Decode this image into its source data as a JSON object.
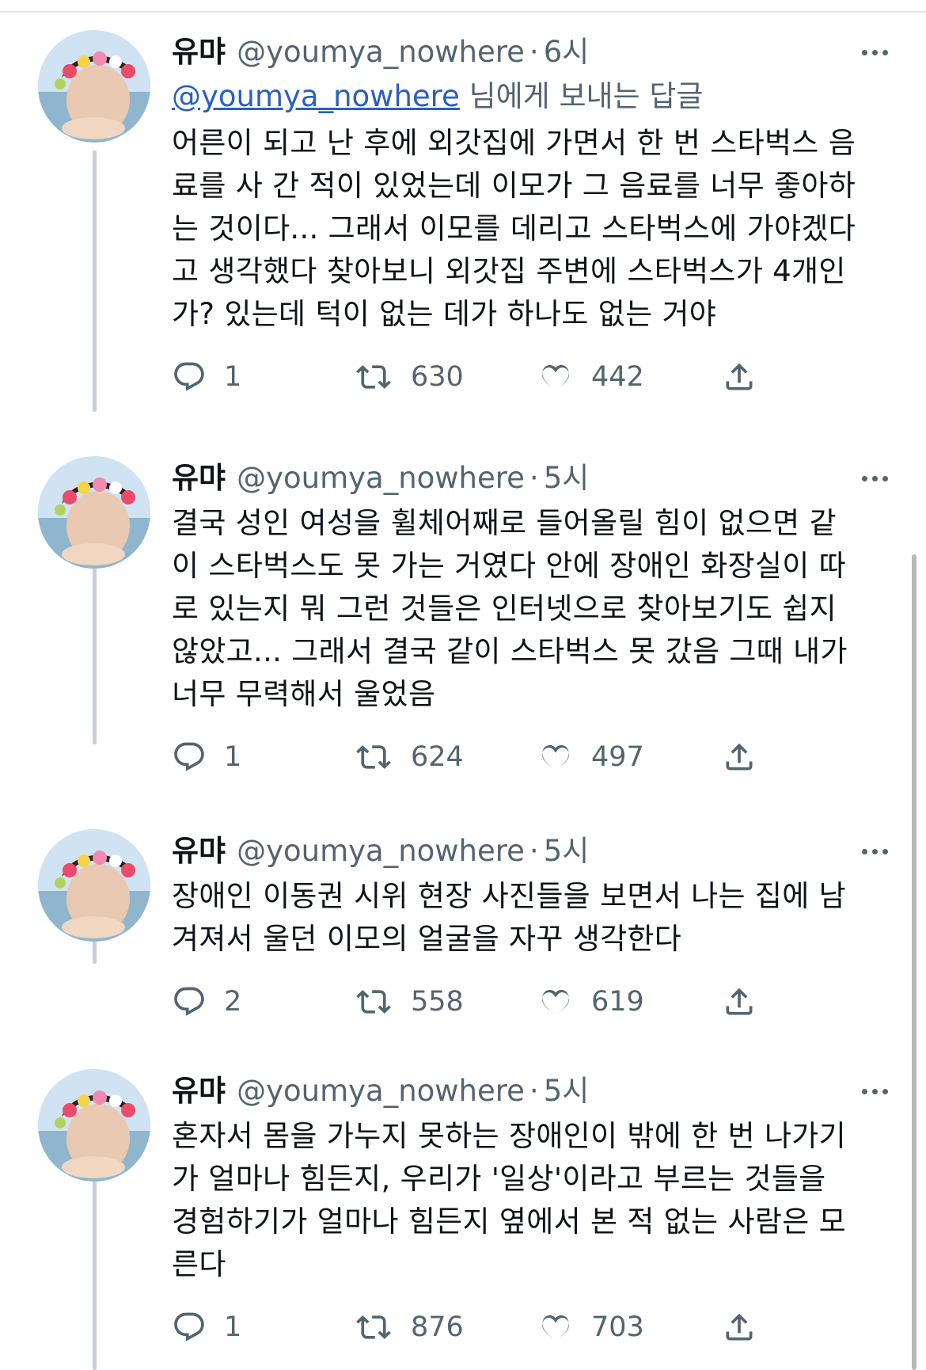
{
  "colors": {
    "text": "#0f1419",
    "secondary": "#536471",
    "link": "#2a5fbf",
    "thread_line": "#c8d0d5"
  },
  "icons": {
    "reply": "reply-icon",
    "retweet": "retweet-icon",
    "like": "heart-icon",
    "share": "share-icon",
    "more": "more-icon"
  },
  "tweets": [
    {
      "name": "유먀",
      "handle": "@youmya_nowhere",
      "separator": "·",
      "time": "6시",
      "reply_to_handle": "@youmya_nowhere",
      "reply_to_suffix": " 님에게 보내는 답글",
      "text": "어른이 되고 난 후에 외갓집에 가면서 한 번 스타벅스 음\n료를 사 간 적이 있었는데 이모가 그 음료를 너무 좋아하\n는 것이다... 그래서 이모를 데리고 스타벅스에 가야겠다\n고 생각했다 찾아보니 외갓집 주변에 스타벅스가 4개인\n가? 있는데 턱이 없는 데가 하나도 없는 거야",
      "replies": "1",
      "retweets": "630",
      "likes": "442"
    },
    {
      "name": "유먀",
      "handle": "@youmya_nowhere",
      "separator": "·",
      "time": "5시",
      "text": "결국 성인 여성을 휠체어째로 들어올릴 힘이 없으면 같\n이 스타벅스도 못 가는 거였다 안에 장애인 화장실이 따\n로 있는지 뭐 그런 것들은 인터넷으로 찾아보기도 쉽지\n않았고... 그래서 결국 같이 스타벅스 못 갔음 그때 내가\n너무 무력해서 울었음",
      "replies": "1",
      "retweets": "624",
      "likes": "497"
    },
    {
      "name": "유먀",
      "handle": "@youmya_nowhere",
      "separator": "·",
      "time": "5시",
      "text": "장애인 이동권 시위 현장 사진들을 보면서 나는 집에 남\n겨져서 울던 이모의 얼굴을 자꾸 생각한다",
      "replies": "2",
      "retweets": "558",
      "likes": "619"
    },
    {
      "name": "유먀",
      "handle": "@youmya_nowhere",
      "separator": "·",
      "time": "5시",
      "text": "혼자서 몸을 가누지 못하는 장애인이 밖에 한 번 나가기\n가 얼마나 힘든지, 우리가 '일상'이라고 부르는 것들을\n경험하기가 얼마나 힘든지 옆에서 본 적 없는 사람은 모\n른다",
      "replies": "1",
      "retweets": "876",
      "likes": "703"
    }
  ]
}
